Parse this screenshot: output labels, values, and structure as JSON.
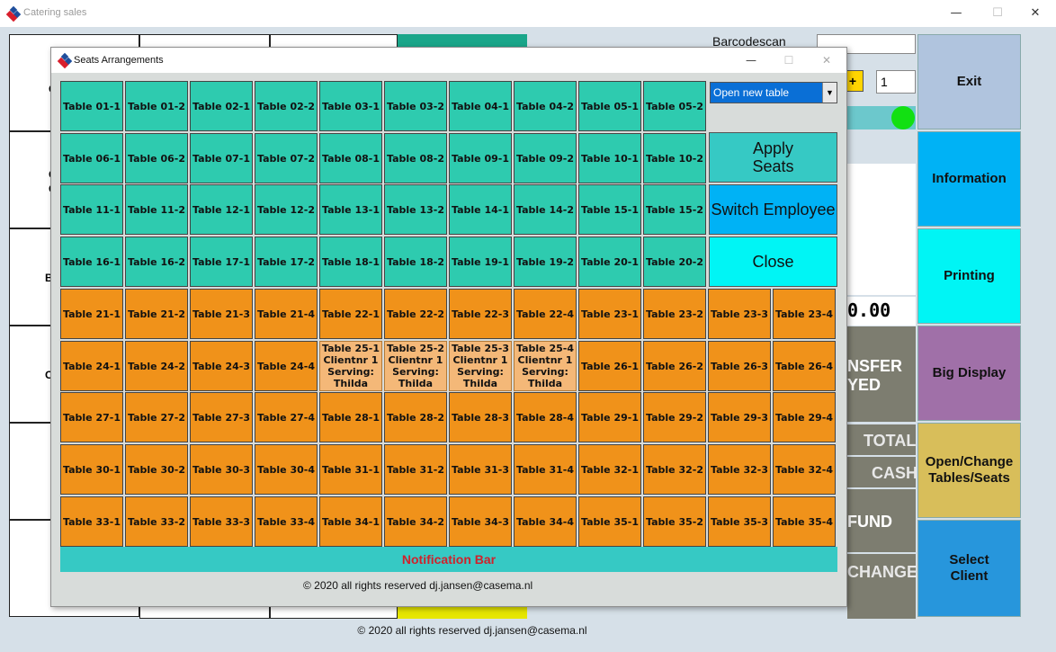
{
  "window": {
    "title": "Catering sales",
    "minimize": "—",
    "maximize": "☐",
    "close": "✕"
  },
  "background": {
    "barcode_label": "Barcodescan",
    "qty_plus": "+",
    "qty_value": "1",
    "amount": "0.00",
    "transfer_label": "NSFER\nYED",
    "total_label": "TOTAL",
    "cash_label": "CASH",
    "refund_label": "FUND",
    "change_label": "CHANGE",
    "left_letters": [
      "C",
      "C\nC",
      "B",
      "C"
    ],
    "status_dot_color": "#12e012"
  },
  "sidebar": [
    {
      "label": "Exit",
      "color": "#b0c4de"
    },
    {
      "label": "Information",
      "color": "#00b2f5"
    },
    {
      "label": "Printing",
      "color": "#00f5f5"
    },
    {
      "label": "Big Display",
      "color": "#a070a8"
    },
    {
      "label": "Open/Change\nTables/Seats",
      "color": "#d8be5a"
    },
    {
      "label": "Select\nClient",
      "color": "#2796dc"
    }
  ],
  "footer": "© 2020 all rights reserved dj.jansen@casema.nl",
  "dialog": {
    "title": "Seats Arrangements",
    "minimize": "—",
    "maximize": "☐",
    "close": "✕",
    "table_select": {
      "value": "Open new table",
      "arrow": "▼"
    },
    "apply_label": "Apply\nSeats",
    "switch_label": "Switch Employee",
    "close_label": "Close",
    "notification": "Notification Bar",
    "footer": "© 2020 all rights reserved dj.jansen@casema.nl",
    "colors": {
      "free_teal": "#2ecbaf",
      "free_orange": "#f0921a",
      "occupied": "#f4b878",
      "apply": "#36c9c4",
      "switch": "#00b2f5",
      "close": "#00f5f5"
    },
    "rows": [
      [
        "Table 01-1",
        "Table 01-2",
        "Table 02-1",
        "Table 02-2",
        "Table 03-1",
        "Table 03-2",
        "Table 04-1",
        "Table 04-2",
        "Table 05-1",
        "Table 05-2"
      ],
      [
        "Table 06-1",
        "Table 06-2",
        "Table 07-1",
        "Table 07-2",
        "Table 08-1",
        "Table 08-2",
        "Table 09-1",
        "Table 09-2",
        "Table 10-1",
        "Table 10-2"
      ],
      [
        "Table 11-1",
        "Table 11-2",
        "Table 12-1",
        "Table 12-2",
        "Table 13-1",
        "Table 13-2",
        "Table 14-1",
        "Table 14-2",
        "Table 15-1",
        "Table 15-2"
      ],
      [
        "Table 16-1",
        "Table 16-2",
        "Table 17-1",
        "Table 17-2",
        "Table 18-1",
        "Table 18-2",
        "Table 19-1",
        "Table 19-2",
        "Table 20-1",
        "Table 20-2"
      ],
      [
        "Table 21-1",
        "Table 21-2",
        "Table 21-3",
        "Table 21-4",
        "Table 22-1",
        "Table 22-2",
        "Table 22-3",
        "Table 22-4",
        "Table 23-1",
        "Table 23-2",
        "Table 23-3",
        "Table 23-4"
      ],
      [
        "Table 24-1",
        "Table 24-2",
        "Table 24-3",
        "Table 24-4",
        "Table 25-1\nClientnr 1\nServing:\nThilda",
        "Table 25-2\nClientnr 1\nServing:\nThilda",
        "Table 25-3\nClientnr 1\nServing:\nThilda",
        "Table 25-4\nClientnr 1\nServing:\nThilda",
        "Table 26-1",
        "Table 26-2",
        "Table 26-3",
        "Table 26-4"
      ],
      [
        "Table 27-1",
        "Table 27-2",
        "Table 27-3",
        "Table 27-4",
        "Table 28-1",
        "Table 28-2",
        "Table 28-3",
        "Table 28-4",
        "Table 29-1",
        "Table 29-2",
        "Table 29-3",
        "Table 29-4"
      ],
      [
        "Table 30-1",
        "Table 30-2",
        "Table 30-3",
        "Table 30-4",
        "Table 31-1",
        "Table 31-2",
        "Table 31-3",
        "Table 31-4",
        "Table 32-1",
        "Table 32-2",
        "Table 32-3",
        "Table 32-4"
      ],
      [
        "Table 33-1",
        "Table 33-2",
        "Table 33-3",
        "Table 33-4",
        "Table 34-1",
        "Table 34-2",
        "Table 34-3",
        "Table 34-4",
        "Table 35-1",
        "Table 35-2",
        "Table 35-3",
        "Table 35-4"
      ]
    ]
  }
}
